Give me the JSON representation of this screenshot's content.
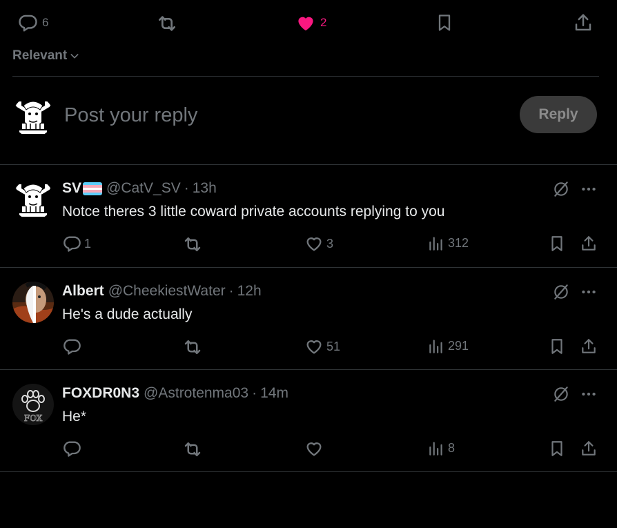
{
  "top_bar": {
    "replies_count": "6",
    "likes_count": "2"
  },
  "sort": {
    "label": "Relevant"
  },
  "composer": {
    "placeholder": "Post your reply",
    "reply_label": "Reply"
  },
  "posts": [
    {
      "name": "SV",
      "handle": "@CatV_SV",
      "dot": "·",
      "time": "13h",
      "text": "Notce theres 3 little coward private accounts replying to you",
      "replies": "1",
      "likes": "3",
      "views": "312"
    },
    {
      "name": "Albert",
      "handle": "@CheekiestWater",
      "dot": "·",
      "time": "12h",
      "text": "He's a dude actually",
      "replies": "",
      "likes": "51",
      "views": "291"
    },
    {
      "name": "FOXDR0N3",
      "handle": "@Astrotenma03",
      "dot": "·",
      "time": "14m",
      "text": "He*",
      "replies": "",
      "likes": "",
      "views": "8",
      "avatar_text": "FOX"
    }
  ],
  "icons": {
    "reply": "speech-bubble-icon",
    "repost": "repost-arrows-icon",
    "like": "heart-icon",
    "views": "bar-chart-icon",
    "bookmark": "bookmark-icon",
    "share": "share-upload-icon",
    "grok": "grok-slash-circle-icon",
    "more": "ellipsis-icon",
    "sort": "chevron-down-icon"
  },
  "colors": {
    "background": "#000000",
    "text": "#e7e9ea",
    "muted": "#71767b",
    "like_active": "#f91880",
    "divider": "#2f3336",
    "reply_button_bg": "#3a3a3a"
  }
}
